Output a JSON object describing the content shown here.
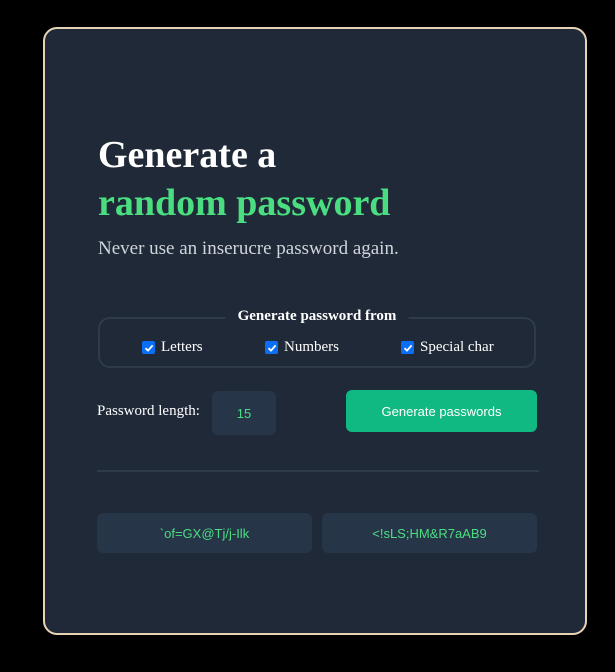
{
  "header": {
    "title_line1": "Generate a",
    "title_line2": "random password",
    "subtitle": "Never use an inserucre password again."
  },
  "options": {
    "legend": "Generate password from",
    "items": [
      {
        "label": "Letters",
        "checked": true
      },
      {
        "label": "Numbers",
        "checked": true
      },
      {
        "label": "Special char",
        "checked": true
      }
    ]
  },
  "length": {
    "label": "Password length:",
    "value": "15"
  },
  "actions": {
    "generate_label": "Generate passwords"
  },
  "passwords": [
    "`of=GX@Tj/j-Ilk",
    "<!sLS;HM&R7aAB9"
  ],
  "colors": {
    "background": "#000000",
    "card": "#1f2937",
    "card_border": "#e8d4b4",
    "accent_green": "#4ade80",
    "button": "#10b981",
    "checkbox": "#0b6ef6"
  }
}
